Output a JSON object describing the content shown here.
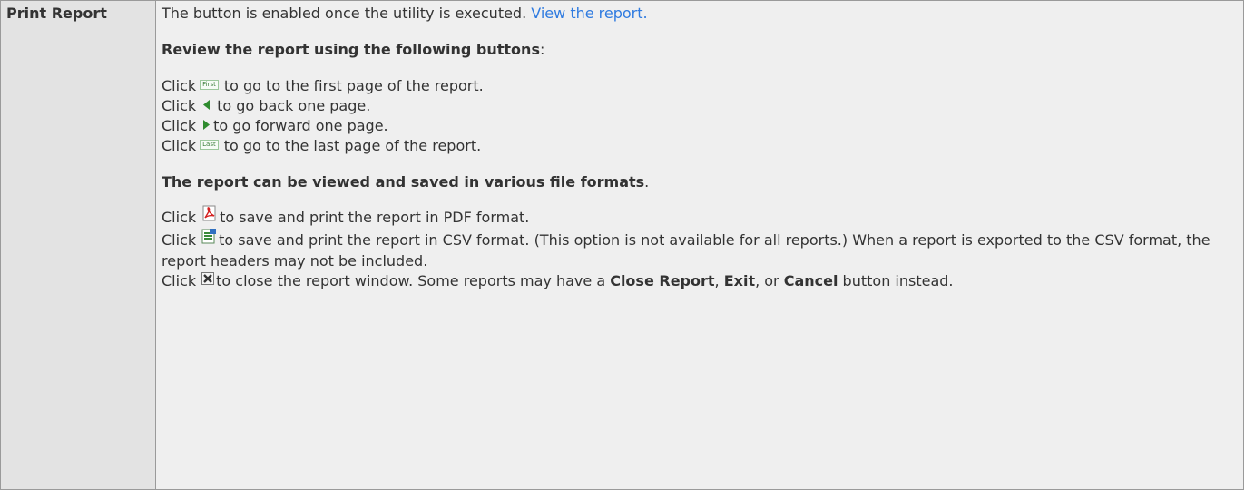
{
  "row": {
    "label": "Print Report",
    "intro_text": "The button is enabled once the utility is executed. ",
    "intro_link": "View the report.",
    "review_heading": "Review the report using the following buttons",
    "review_colon": ":",
    "nav_items": [
      {
        "prefix": "Click",
        "button_text": "First",
        "suffix": "to go to the first page of the report."
      },
      {
        "prefix": "Click",
        "suffix": "to go back one page."
      },
      {
        "prefix": "Click",
        "suffix": "to go forward one page."
      },
      {
        "prefix": "Click",
        "button_text": "Last",
        "suffix": "to go to the last page of the report."
      }
    ],
    "formats_heading": "The report can be viewed and saved in various file formats",
    "formats_period": ".",
    "pdf_line": {
      "prefix": "Click",
      "suffix": "to save and print the report in PDF format."
    },
    "csv_line": {
      "prefix": "Click",
      "suffix": "to save and print the report in CSV format. (This option is not available for all reports.) When a report is exported to the CSV format, the report headers may not be included."
    },
    "close_line": {
      "prefix": "Click",
      "part1": "to close the report window. Some reports may have a ",
      "close_report": "Close Report",
      "sep1": ", ",
      "exit": "Exit",
      "sep2": ", or ",
      "cancel": "Cancel",
      "part2": " button instead."
    }
  },
  "icons": {
    "first_button": "first-page-button-icon",
    "prev": "previous-page-arrow-icon",
    "next": "next-page-arrow-icon",
    "last_button": "last-page-button-icon",
    "pdf": "pdf-file-icon",
    "csv": "csv-spreadsheet-icon",
    "close": "close-x-icon"
  },
  "colors": {
    "link": "#2f7be0",
    "nav_arrow": "#2e8b2e",
    "pdf_red": "#d42020",
    "close_gray": "#444444"
  }
}
